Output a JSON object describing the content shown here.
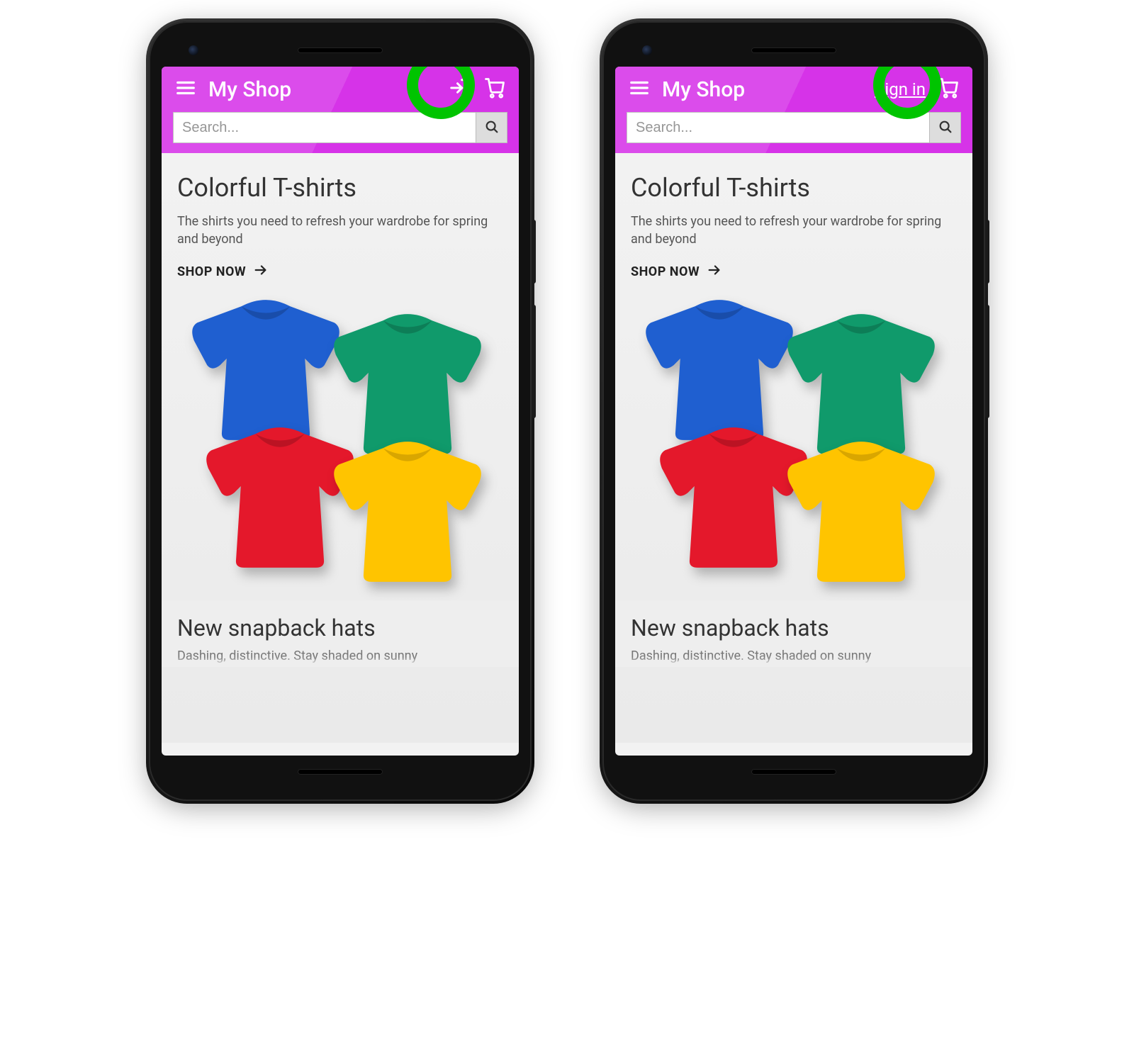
{
  "phones": [
    {
      "signin_mode": "icon"
    },
    {
      "signin_mode": "text"
    }
  ],
  "header": {
    "title": "My Shop",
    "signin_label": "Sign in"
  },
  "search": {
    "placeholder": "Search..."
  },
  "hero": {
    "title": "Colorful T-shirts",
    "subtitle": "The shirts you need to refresh your wardrobe for spring and beyond",
    "cta": "SHOP NOW"
  },
  "section2": {
    "title": "New snapback hats",
    "subtitle_truncated": "Dashing, distinctive. Stay shaded on sunny"
  },
  "colors": {
    "brand": "#d633e8",
    "highlight": "#00c400",
    "tee_blue": "#1f5fd0",
    "tee_green": "#109a6b",
    "tee_red": "#e4182b",
    "tee_yellow": "#ffc400"
  }
}
